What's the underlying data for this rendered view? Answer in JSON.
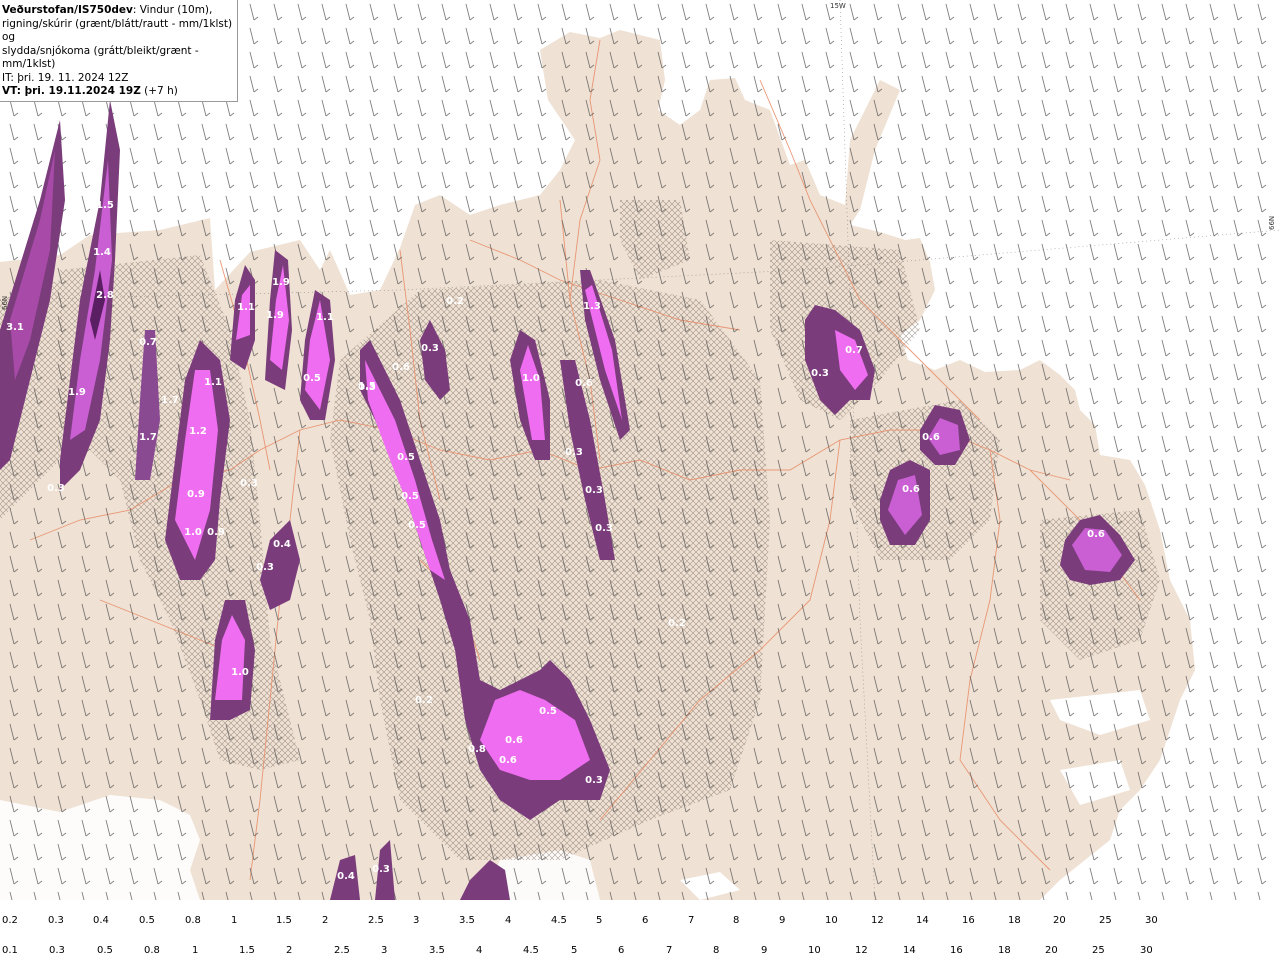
{
  "header": {
    "brand": "Veðurstofan/IS750dev",
    "desc1": ": Vindur (10m),",
    "desc2": "rigning/skúrir (grænt/blátt/rautt - mm/1klst) og",
    "desc3": "slydda/snjókoma (grátt/bleikt/grænt - mm/1klst)",
    "it": "IT: þri. 19. 11. 2024 12Z",
    "vt_bold": "VT: þri. 19.11.2024 19Z",
    "vt_offset": " (+7 h)"
  },
  "grid_labels": {
    "top": "15W",
    "right": "66N",
    "left": "66N"
  },
  "colors": {
    "land": "#efe1d3",
    "sea": "#ffffff",
    "roads": "#e88e6a",
    "barbs": "#555555"
  },
  "precip_labels": [
    {
      "t": "3.1",
      "kind": "snow"
    },
    {
      "t": "2.8",
      "kind": "snow"
    },
    {
      "t": "1.4",
      "kind": "snow"
    },
    {
      "t": "1.9",
      "kind": "snow"
    },
    {
      "t": "1.5",
      "kind": "snow"
    },
    {
      "t": "0.7",
      "kind": "snow"
    },
    {
      "t": "1.7",
      "kind": "snow"
    },
    {
      "t": "1.7",
      "kind": "snow"
    },
    {
      "t": "1.2",
      "kind": "snow"
    },
    {
      "t": "1.1",
      "kind": "snow"
    },
    {
      "t": "0.9",
      "kind": "snow"
    },
    {
      "t": "1.0",
      "kind": "snow"
    },
    {
      "t": "0.9",
      "kind": "snow"
    },
    {
      "t": "0.3",
      "kind": "snow"
    },
    {
      "t": "0.3",
      "kind": "snow"
    },
    {
      "t": "1.1",
      "kind": "snow"
    },
    {
      "t": "1.9",
      "kind": "snow"
    },
    {
      "t": "1.9",
      "kind": "snow"
    },
    {
      "t": "1.1",
      "kind": "snow"
    },
    {
      "t": "0.5",
      "kind": "snow"
    },
    {
      "t": "1.5",
      "kind": "snow"
    },
    {
      "t": "0.6",
      "kind": "snow"
    },
    {
      "t": "0.3",
      "kind": "snow"
    },
    {
      "t": "0.5",
      "kind": "snow"
    },
    {
      "t": "0.5",
      "kind": "snow"
    },
    {
      "t": "0.5",
      "kind": "snow"
    },
    {
      "t": "0.4",
      "kind": "snow"
    },
    {
      "t": "0.3",
      "kind": "snow"
    },
    {
      "t": "1.0",
      "kind": "snow"
    },
    {
      "t": "0.6",
      "kind": "snow"
    },
    {
      "t": "0.8",
      "kind": "snow"
    },
    {
      "t": "0.6",
      "kind": "snow"
    },
    {
      "t": "0.6",
      "kind": "snow"
    },
    {
      "t": "0.5",
      "kind": "snow"
    },
    {
      "t": "0.3",
      "kind": "snow"
    },
    {
      "t": "1.0",
      "kind": "snow"
    },
    {
      "t": "0.3",
      "kind": "snow"
    },
    {
      "t": "0.3",
      "kind": "snow"
    },
    {
      "t": "0.3",
      "kind": "snow"
    },
    {
      "t": "0.3",
      "kind": "snow"
    },
    {
      "t": "1.3",
      "kind": "snow"
    },
    {
      "t": "0.3",
      "kind": "snow"
    },
    {
      "t": "0.7",
      "kind": "snow"
    },
    {
      "t": "0.6",
      "kind": "snow"
    },
    {
      "t": "0.6",
      "kind": "snow"
    },
    {
      "t": "0.6",
      "kind": "snow"
    },
    {
      "t": "0.4",
      "kind": "snow"
    },
    {
      "t": "0.3",
      "kind": "snow"
    },
    {
      "t": "0.2",
      "kind": "snow"
    },
    {
      "t": "0.2",
      "kind": "snow"
    },
    {
      "t": "0.2",
      "kind": "snow"
    }
  ],
  "legend_snow": {
    "colors": [
      "#5a3a5e",
      "#6b3e72",
      "#8a4a92",
      "#b15fbd",
      "#ef6df0",
      "#c95fd3",
      "#a84aa8",
      "#7a3c7b",
      "#3c0040",
      "#5a1f62",
      "#7a3a84",
      "#9b93c8",
      "#b9b1ea",
      "#d6d1fa",
      "#8f96b5",
      "#6e7fa0",
      "#536c86",
      "#3f5e71",
      "#2c4e58",
      "#1e4c4c",
      "#285e5a",
      "#3a6e6a",
      "#4c807b",
      "#5f908b",
      "#77a39f",
      "#96b8b5",
      "#c5d5d4",
      "#ffffff"
    ],
    "labels": [
      "0.2",
      "0.3",
      "0.4",
      "0.5",
      "0.8",
      "1",
      "1.5",
      "2",
      "2.5",
      "3",
      "3.5",
      "4",
      "4.5",
      "5",
      "6",
      "7",
      "8",
      "9",
      "10",
      "12",
      "14",
      "16",
      "18",
      "20",
      "25",
      "30"
    ]
  },
  "legend_rain": {
    "colors": [
      "#e9fbe6",
      "#b7e6ad",
      "#8dcf86",
      "#5fae5c",
      "#0f4f10",
      "#2e6f34",
      "#3d8046",
      "#4b8c56",
      "#5a9868",
      "#6f9f87",
      "#86a7a0",
      "#9aa9bb",
      "#aab2d8",
      "#bcbff0",
      "#9aa0e8",
      "#7f84dc",
      "#6468d0",
      "#4448c0",
      "#1e20a8",
      "#0a0aa0",
      "#5a3ab8",
      "#a070e0",
      "#e9b8ee",
      "#f090c8",
      "#f07090",
      "#e83040",
      "#ee0a10"
    ],
    "labels": [
      "0.1",
      "0.3",
      "0.5",
      "0.8",
      "1",
      "1.5",
      "2",
      "2.5",
      "3",
      "3.5",
      "4",
      "4.5",
      "5",
      "6",
      "7",
      "8",
      "9",
      "10",
      "12",
      "14",
      "16",
      "18",
      "20",
      "25",
      "30"
    ]
  }
}
